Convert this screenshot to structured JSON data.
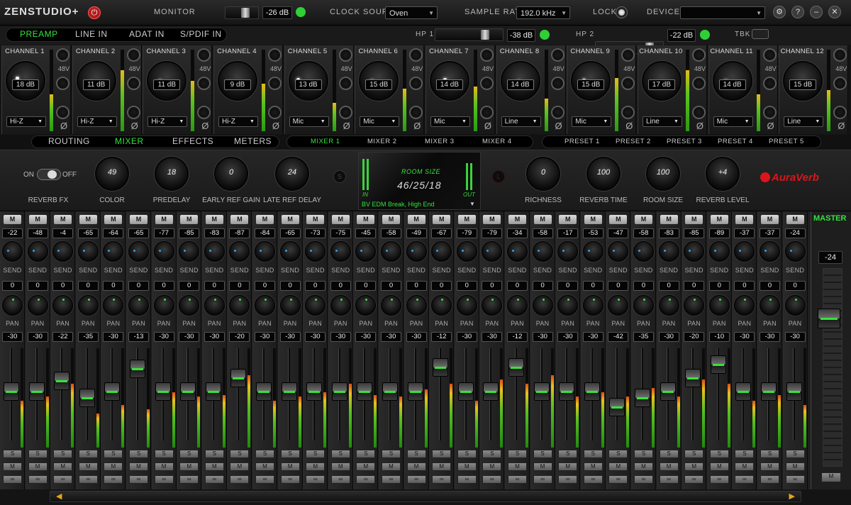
{
  "app": {
    "logo": "ZENSTUDIO+"
  },
  "topbar": {
    "monitor_label": "MONITOR",
    "monitor_value": "-26 dB",
    "clock_label": "CLOCK SOURCE",
    "clock_value": "Oven",
    "rate_label": "SAMPLE RATE",
    "rate_value": "192.0 kHz",
    "lock_label": "LOCK",
    "devices_label": "DEVICES",
    "devices_value": "",
    "settings_icon": "gear-icon",
    "help_label": "?",
    "min_label": "–",
    "close_label": "✕"
  },
  "nav": {
    "tabs": [
      {
        "label": "PREAMP"
      },
      {
        "label": "LINE IN"
      },
      {
        "label": "ADAT IN"
      },
      {
        "label": "S/PDIF IN"
      }
    ],
    "active": "PREAMP",
    "hp1_label": "HP 1",
    "hp1_value": "-38 dB",
    "hp2_label": "HP 2",
    "hp2_value": "-22 dB",
    "tbk_label": "TBK"
  },
  "channels": [
    {
      "name": "CHANNEL 1",
      "gain": "18 dB",
      "source": "Hi-Z",
      "meter": 0.45
    },
    {
      "name": "CHANNEL 2",
      "gain": "11 dB",
      "source": "Hi-Z",
      "meter": 0.75
    },
    {
      "name": "CHANNEL 3",
      "gain": "11 dB",
      "source": "Hi-Z",
      "meter": 0.62
    },
    {
      "name": "CHANNEL 4",
      "gain": "9 dB",
      "source": "Hi-Z",
      "meter": 0.58
    },
    {
      "name": "CHANNEL 5",
      "gain": "13 dB",
      "source": "Mic",
      "meter": 0.35
    },
    {
      "name": "CHANNEL 6",
      "gain": "15 dB",
      "source": "Mic",
      "meter": 0.52
    },
    {
      "name": "CHANNEL 7",
      "gain": "14 dB",
      "source": "Mic",
      "meter": 0.55
    },
    {
      "name": "CHANNEL 8",
      "gain": "14 dB",
      "source": "Line",
      "meter": 0.4
    },
    {
      "name": "CHANNEL 9",
      "gain": "15 dB",
      "source": "Mic",
      "meter": 0.65
    },
    {
      "name": "CHANNEL 10",
      "gain": "17 dB",
      "source": "Line",
      "meter": 0.75
    },
    {
      "name": "CHANNEL 11",
      "gain": "14 dB",
      "source": "Mic",
      "meter": 0.45
    },
    {
      "name": "CHANNEL 12",
      "gain": "15 dB",
      "source": "Line",
      "meter": 0.5
    }
  ],
  "ch_buttons": {
    "phantom": "48V",
    "phase": "Ø"
  },
  "midtabs": {
    "main": [
      {
        "label": "ROUTING"
      },
      {
        "label": "MIXER"
      },
      {
        "label": "EFFECTS"
      },
      {
        "label": "METERS"
      }
    ],
    "main_active": "MIXER",
    "mixers": [
      {
        "label": "MIXER 1"
      },
      {
        "label": "MIXER 2"
      },
      {
        "label": "MIXER 3"
      },
      {
        "label": "MIXER 4"
      }
    ],
    "mixer_active": "MIXER 1",
    "presets": [
      {
        "label": "PRESET 1"
      },
      {
        "label": "PRESET 2"
      },
      {
        "label": "PRESET 3"
      },
      {
        "label": "PRESET 4"
      },
      {
        "label": "PRESET 5"
      }
    ]
  },
  "reverb": {
    "toggle_on": "ON",
    "toggle_off": "OFF",
    "fx_label": "REVERB FX",
    "color": {
      "label": "COLOR",
      "value": "49"
    },
    "predelay": {
      "label": "PREDELAY",
      "value": "18"
    },
    "early": {
      "label": "EARLY REF GAIN",
      "value": "0"
    },
    "late": {
      "label": "LATE REF DELAY",
      "value": "24"
    },
    "s_label": "S",
    "l_label": "L",
    "display_title": "ROOM SIZE",
    "display_value": "46/25/18",
    "in_label": "IN",
    "out_label": "OUT",
    "preset_name": "BV EDM Break, High End",
    "richness": {
      "label": "RICHNESS",
      "value": "0"
    },
    "time": {
      "label": "REVERB TIME",
      "value": "100"
    },
    "room": {
      "label": "ROOM SIZE",
      "value": "100"
    },
    "level": {
      "label": "REVERB LEVEL",
      "value": "+4"
    },
    "brand": "AuraVerb"
  },
  "mixer": {
    "mute_label": "M",
    "send_label": "SEND",
    "pan_label": "PAN",
    "solo_label": "S",
    "channels": [
      {
        "send": "-22",
        "pan": "0",
        "fader": "-30",
        "meter": 0.55
      },
      {
        "send": "-48",
        "pan": "0",
        "fader": "-30",
        "meter": 0.6
      },
      {
        "send": "-4",
        "pan": "0",
        "fader": "-22",
        "meter": 0.75
      },
      {
        "send": "-65",
        "pan": "0",
        "fader": "-35",
        "meter": 0.4
      },
      {
        "send": "-64",
        "pan": "0",
        "fader": "-30",
        "meter": 0.5
      },
      {
        "send": "-65",
        "pan": "0",
        "fader": "-13",
        "meter": 0.45
      },
      {
        "send": "-77",
        "pan": "0",
        "fader": "-30",
        "meter": 0.65
      },
      {
        "send": "-85",
        "pan": "0",
        "fader": "-30",
        "meter": 0.6
      },
      {
        "send": "-83",
        "pan": "0",
        "fader": "-30",
        "meter": 0.62
      },
      {
        "send": "-87",
        "pan": "0",
        "fader": "-20",
        "meter": 0.85
      },
      {
        "send": "-84",
        "pan": "0",
        "fader": "-30",
        "meter": 0.55
      },
      {
        "send": "-65",
        "pan": "0",
        "fader": "-30",
        "meter": 0.6
      },
      {
        "send": "-73",
        "pan": "0",
        "fader": "-30",
        "meter": 0.65
      },
      {
        "send": "-75",
        "pan": "0",
        "fader": "-30",
        "meter": 0.75
      },
      {
        "send": "-45",
        "pan": "0",
        "fader": "-30",
        "meter": 0.62
      },
      {
        "send": "-58",
        "pan": "0",
        "fader": "-30",
        "meter": 0.6
      },
      {
        "send": "-49",
        "pan": "0",
        "fader": "-30",
        "meter": 0.68
      },
      {
        "send": "-67",
        "pan": "0",
        "fader": "-12",
        "meter": 0.75
      },
      {
        "send": "-79",
        "pan": "0",
        "fader": "-30",
        "meter": 0.55
      },
      {
        "send": "-79",
        "pan": "0",
        "fader": "-30",
        "meter": 0.8
      },
      {
        "send": "-34",
        "pan": "0",
        "fader": "-12",
        "meter": 0.75
      },
      {
        "send": "-58",
        "pan": "0",
        "fader": "-30",
        "meter": 0.85
      },
      {
        "send": "-17",
        "pan": "0",
        "fader": "-30",
        "meter": 0.6
      },
      {
        "send": "-53",
        "pan": "0",
        "fader": "-30",
        "meter": 0.65
      },
      {
        "send": "-47",
        "pan": "0",
        "fader": "-42",
        "meter": 0.6
      },
      {
        "send": "-58",
        "pan": "0",
        "fader": "-35",
        "meter": 0.7
      },
      {
        "send": "-83",
        "pan": "0",
        "fader": "-30",
        "meter": 0.6
      },
      {
        "send": "-85",
        "pan": "0",
        "fader": "-20",
        "meter": 0.8
      },
      {
        "send": "-89",
        "pan": "0",
        "fader": "-10",
        "meter": 0.75
      },
      {
        "send": "-37",
        "pan": "0",
        "fader": "-30",
        "meter": 0.55
      },
      {
        "send": "-37",
        "pan": "0",
        "fader": "-30",
        "meter": 0.62
      },
      {
        "send": "-24",
        "pan": "0",
        "fader": "-30",
        "meter": 0.5
      }
    ],
    "master_label": "MASTER",
    "master_value": "-24"
  },
  "colors": {
    "accent": "#35e33d",
    "brand": "#d8161b"
  }
}
